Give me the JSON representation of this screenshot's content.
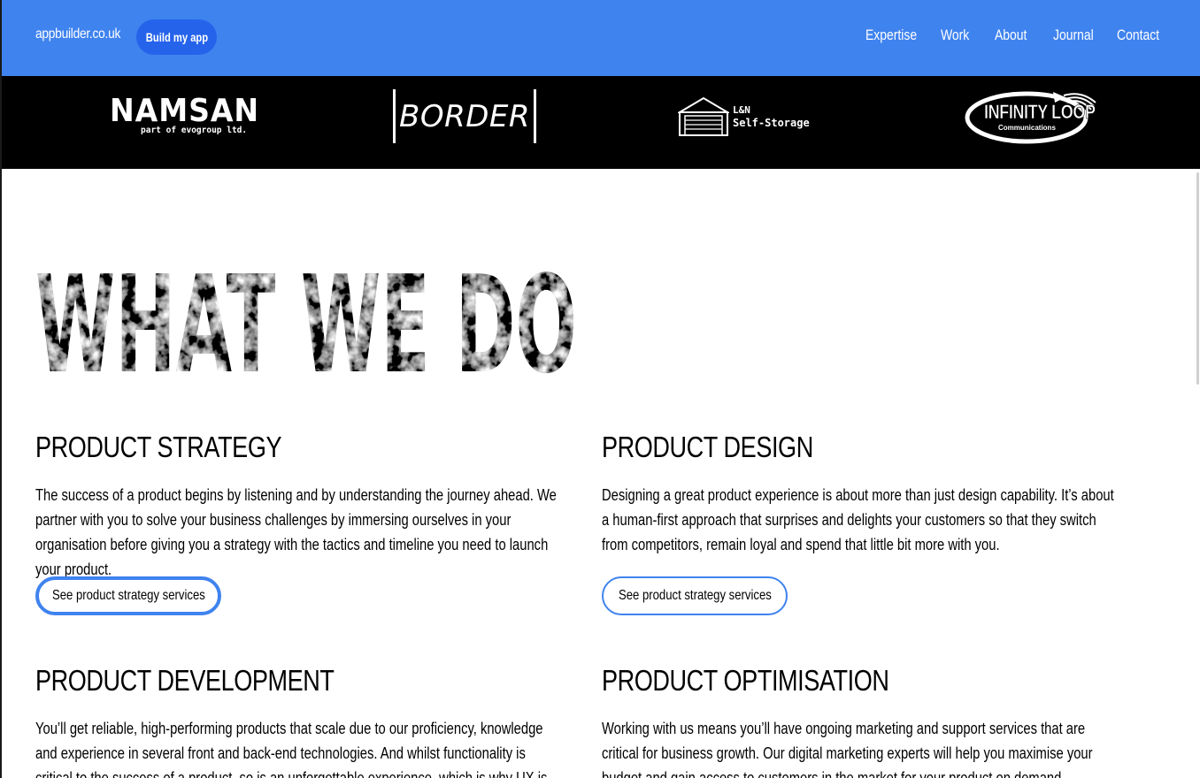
{
  "header": {
    "brand": "appbuilder.co.uk",
    "cta_label": "Build my app",
    "nav": [
      "Expertise",
      "Work",
      "About",
      "Journal",
      "Contact"
    ],
    "colors": {
      "bar": "#3f83ef",
      "cta": "#2563eb"
    }
  },
  "logos": {
    "namsan": {
      "name": "NAMSAN",
      "tagline": "part of evogroup ltd."
    },
    "border": {
      "name": "BORDER"
    },
    "ln": {
      "line1": "L&N",
      "line2": "Self-Storage",
      "icon": "garage-icon"
    },
    "infinity": {
      "name": "INFINITY LOOP",
      "sub": "Communications"
    }
  },
  "hero": {
    "title": "WHAT WE DO"
  },
  "services": [
    {
      "title": "PRODUCT STRATEGY",
      "text": "The success of a product begins by listening and by understanding the journey ahead. We partner with you to solve your business challenges by immersing ourselves in your organisation before giving you a strategy with the tactics and timeline you need to launch your product.",
      "button": "See product strategy services"
    },
    {
      "title": "PRODUCT DESIGN",
      "text": "Designing a great product experience is about more than just design capability. It’s about a human-first approach that surprises and delights your customers so that they switch from competitors, remain loyal and spend that little bit more with you.",
      "button": "See product strategy services"
    },
    {
      "title": "PRODUCT DEVELOPMENT",
      "text": "You’ll get reliable, high-performing products that scale due to our proficiency, knowledge and experience in several front and back-end technologies. And whilst functionality is critical to the success of a product, so is an unforgettable experience, which is why UX is paramount to our"
    },
    {
      "title": "PRODUCT OPTIMISATION",
      "text": "Working with us means you’ll have ongoing marketing and support services that are critical for business growth. Our digital marketing experts will help you maximise your budget and gain access to customers in the market for your product on demand."
    }
  ]
}
